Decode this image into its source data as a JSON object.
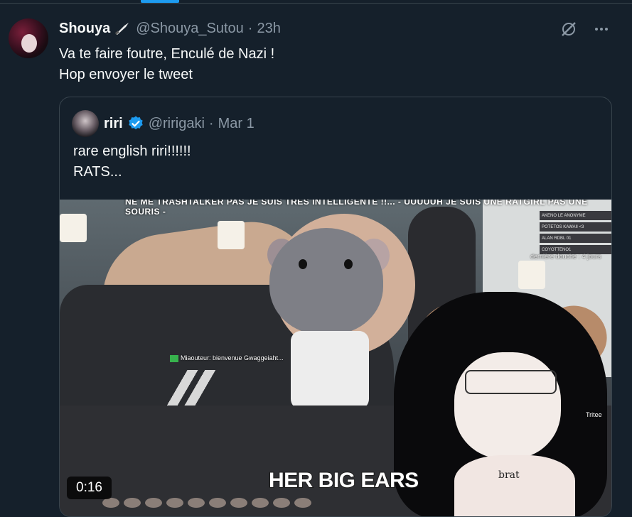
{
  "tweet": {
    "author_name": "Shouya",
    "author_handle": "@Shouya_Sutou",
    "separator": "·",
    "time": "23h",
    "text": "Va te faire foutre, Enculé de Nazi !\nHop envoyer le tweet",
    "icons": {
      "badge": "knife-icon",
      "grok": "grok-icon",
      "more": "more-icon"
    }
  },
  "quote": {
    "author_name": "riri",
    "author_handle": "@ririgaki",
    "separator": "·",
    "date": "Mar 1",
    "text": "rare english riri!!!!!!\nRATS...",
    "verified_color": "#1d9bf0",
    "media": {
      "banner": "NE ME TRASHTALKER PAS JE SUIS TRES INTELLIGENTE !!... - UUUUUH JE SUIS UNE RATGIRL PAS UNE SOURIS -",
      "leaderboard": [
        {
          "name": "AKENO LE ANONYME",
          "value": ""
        },
        {
          "name": "POTETOS KAWAII <3",
          "value": ""
        },
        {
          "name": "ALAN RDBL 01",
          "value": ""
        },
        {
          "name": "COYOTTENO1",
          "value": ""
        }
      ],
      "shower_note": "dernière douche : 4 jours",
      "chat_line": "Miaouteur: bienvenue Gwaggeiaht...",
      "side_label": "Tritee",
      "caption": "HER BIG EARS",
      "brat_text": "brat",
      "duration": "0:16"
    }
  }
}
